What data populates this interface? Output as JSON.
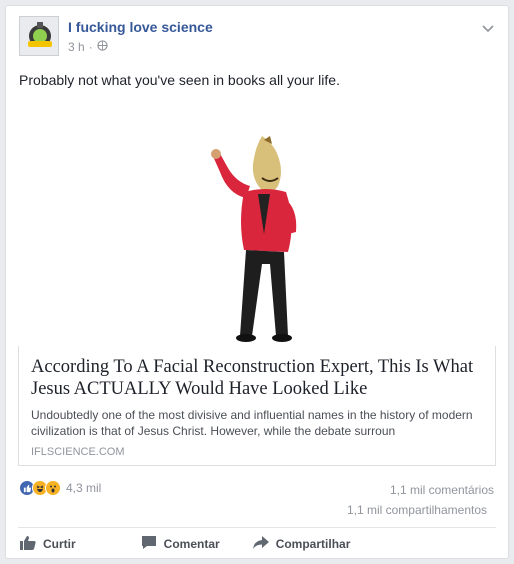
{
  "post": {
    "page_name": "I fucking love science",
    "time": "3 h",
    "separator": "·",
    "text": "Probably not what you've seen in books all your life."
  },
  "link": {
    "title": "According To A Facial Reconstruction Expert, This Is What Jesus ACTUALLY Would Have Looked Like",
    "description": "Undoubtedly one of the most divisive and influential names in the history of modern civilization is that of Jesus Christ. However, while the debate surroun",
    "domain": "IFLSCIENCE.COM"
  },
  "stats": {
    "reactions": "4,3 mil",
    "comments": "1,1 mil comentários",
    "shares": "1,1 mil compartilhamentos"
  },
  "actions": {
    "like": "Curtir",
    "comment": "Comentar",
    "share": "Compartilhar"
  },
  "icons": [
    "globe-icon",
    "chevron-down-icon",
    "like-reaction-icon",
    "haha-reaction-icon",
    "wow-reaction-icon",
    "thumbs-up-icon",
    "comment-icon",
    "share-arrow-icon"
  ],
  "colors": {
    "link": "#365899",
    "muted": "#90949c",
    "like_blue": "#4267b2",
    "reaction_yellow": "#f7b125"
  }
}
